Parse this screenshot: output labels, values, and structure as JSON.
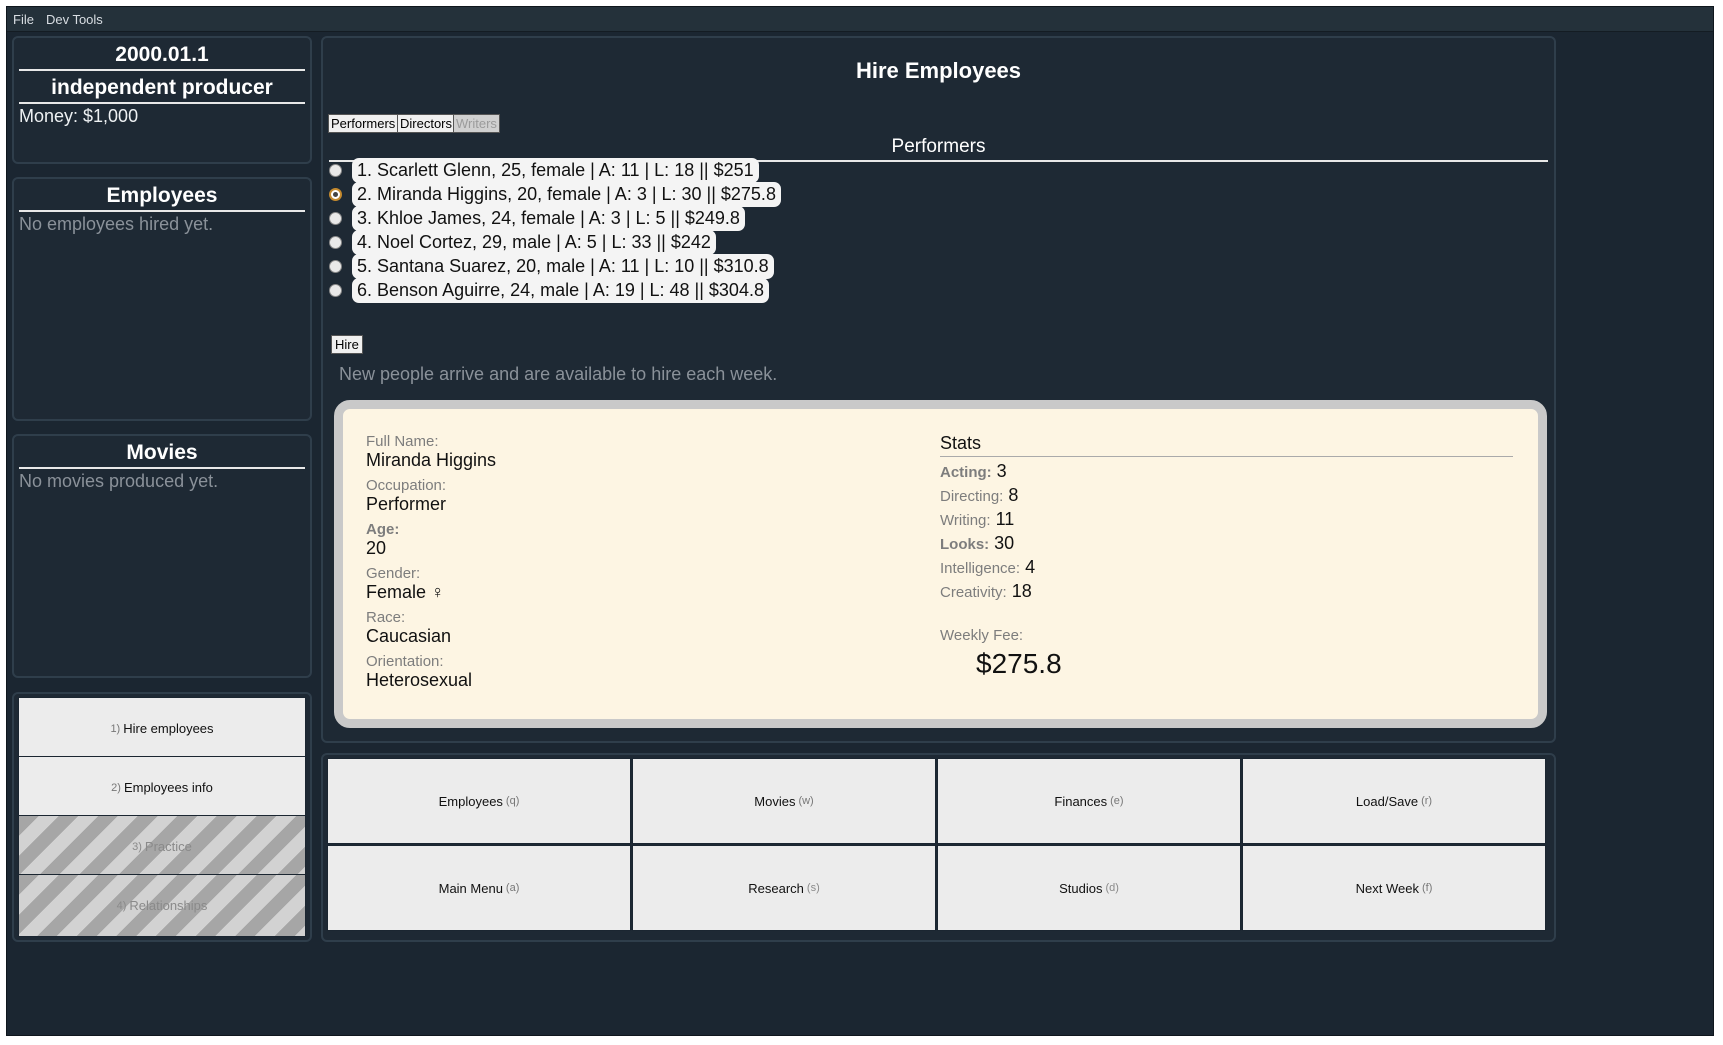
{
  "menu": [
    "File",
    "Dev Tools"
  ],
  "status": {
    "date": "2000.01.1",
    "title": "independent producer",
    "money": "Money: $1,000"
  },
  "employees_panel": {
    "title": "Employees",
    "empty": "No employees hired yet."
  },
  "movies_panel": {
    "title": "Movies",
    "empty": "No movies produced yet."
  },
  "side_actions": [
    {
      "key": "1)",
      "label": "Hire employees",
      "enabled": true
    },
    {
      "key": "2)",
      "label": "Employees info",
      "enabled": true
    },
    {
      "key": "3)",
      "label": "Practice",
      "enabled": false
    },
    {
      "key": "4)",
      "label": "Relationships",
      "enabled": false
    }
  ],
  "hire": {
    "title": "Hire Employees",
    "tabs": [
      {
        "label": "Performers",
        "enabled": true
      },
      {
        "label": "Directors",
        "enabled": true
      },
      {
        "label": "Writers",
        "enabled": false
      }
    ],
    "section_title": "Performers",
    "candidates": [
      {
        "label": "1. Scarlett Glenn, 25, female | A: 11 | L: 18 || $251",
        "selected": false
      },
      {
        "label": "2. Miranda Higgins, 20, female | A: 3 | L: 30 || $275.8",
        "selected": true
      },
      {
        "label": "3. Khloe James, 24, female | A: 3 | L: 5 || $249.8",
        "selected": false
      },
      {
        "label": "4. Noel Cortez, 29, male | A: 5 | L: 33 || $242",
        "selected": false
      },
      {
        "label": "5. Santana Suarez, 20, male | A: 11 | L: 10 || $310.8",
        "selected": false
      },
      {
        "label": "6. Benson Aguirre, 24, male | A: 19 | L: 48 || $304.8",
        "selected": false
      }
    ],
    "hire_button": "Hire",
    "note": "New people arrive and are available to hire each week."
  },
  "detail": {
    "full_name_label": "Full Name:",
    "full_name": "Miranda Higgins",
    "occupation_label": "Occupation:",
    "occupation": "Performer",
    "age_label": "Age:",
    "age": "20",
    "gender_label": "Gender:",
    "gender": "Female ♀",
    "race_label": "Race:",
    "race": "Caucasian",
    "orientation_label": "Orientation:",
    "orientation": "Heterosexual",
    "stats_title": "Stats",
    "stats": [
      {
        "label": "Acting:",
        "value": "3",
        "bold": true
      },
      {
        "label": "Directing:",
        "value": "8",
        "bold": false
      },
      {
        "label": "Writing:",
        "value": "11",
        "bold": false
      },
      {
        "label": "Looks:",
        "value": "30",
        "bold": true
      },
      {
        "label": "Intelligence:",
        "value": "4",
        "bold": false
      },
      {
        "label": "Creativity:",
        "value": "18",
        "bold": false
      }
    ],
    "fee_label": "Weekly Fee:",
    "fee": "$275.8"
  },
  "bottom_nav": [
    {
      "label": "Employees",
      "key": "(q)",
      "enabled": true
    },
    {
      "label": "Movies",
      "key": "(w)",
      "enabled": true
    },
    {
      "label": "Finances",
      "key": "(e)",
      "enabled": true
    },
    {
      "label": "Load/Save",
      "key": "(r)",
      "enabled": true
    },
    {
      "label": "Main Menu",
      "key": "(a)",
      "enabled": true
    },
    {
      "label": "Research",
      "key": "(s)",
      "enabled": false
    },
    {
      "label": "Studios",
      "key": "(d)",
      "enabled": false
    },
    {
      "label": "Next Week",
      "key": "(f)",
      "enabled": true
    }
  ]
}
